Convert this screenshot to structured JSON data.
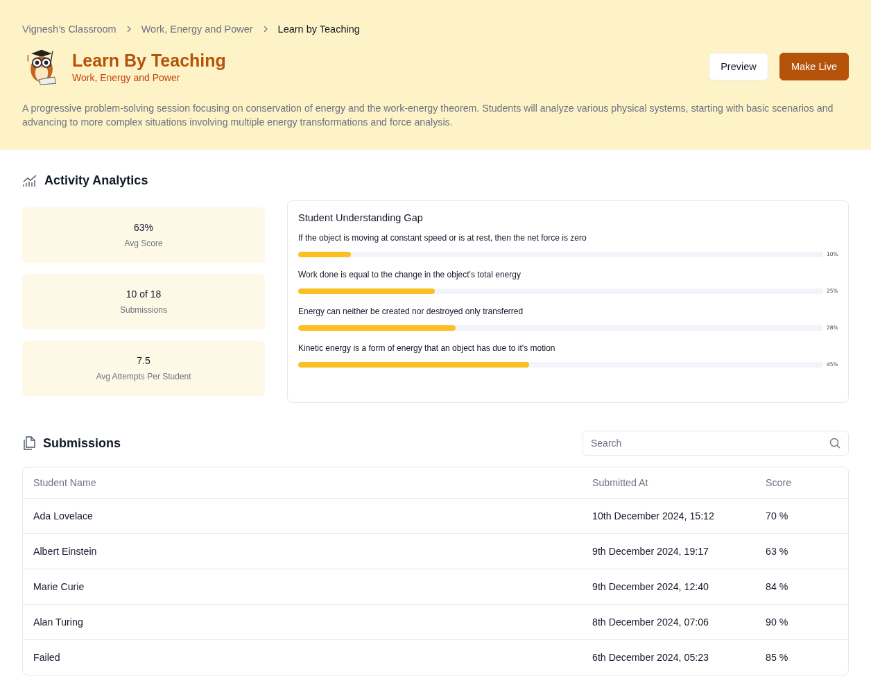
{
  "breadcrumbs": [
    {
      "label": "Vignesh’s Classroom",
      "current": false
    },
    {
      "label": "Work, Energy and Power",
      "current": false
    },
    {
      "label": "Learn by Teaching",
      "current": true
    }
  ],
  "header": {
    "title": "Learn By Teaching",
    "subtitle": "Work, Energy and Power",
    "description": "A progressive problem-solving session focusing on conservation of energy and the work-energy theorem. Students will analyze various physical systems, starting with basic scenarios and advancing to more complex situations involving multiple energy transformations and force analysis."
  },
  "buttons": [
    {
      "label": "Preview",
      "kind": "secondary"
    },
    {
      "label": "Make Live",
      "kind": "primary"
    }
  ],
  "analytics": {
    "title": "Activity Analytics",
    "stats": [
      {
        "value": "63%",
        "label": "Avg Score"
      },
      {
        "value": "10 of 18",
        "label": "Submissions"
      },
      {
        "value": "7.5",
        "label": "Avg Attempts Per Student"
      }
    ],
    "gap": {
      "title": "Student Understanding Gap",
      "items": [
        {
          "text": "If the object is moving at constant speed or is at rest, then the net force is zero",
          "level": 0.1,
          "reading": "10%"
        },
        {
          "text": "Work done is equal to the change in the object's total energy",
          "level": 0.26,
          "reading": "25%"
        },
        {
          "text": "Energy can neither be created nor destroyed only transferred",
          "level": 0.3,
          "reading": "28%"
        },
        {
          "text": "Kinetic energy is a form of energy that an object has due to it's motion",
          "level": 0.44,
          "reading": "45%"
        }
      ]
    }
  },
  "submissions": {
    "title": "Submissions",
    "search": {
      "placeholder": "Search"
    },
    "columns": [
      "Student Name",
      "Submitted At",
      "Score"
    ],
    "rows": [
      [
        "Ada Lovelace",
        "10th December 2024, 15:12",
        "70 %"
      ],
      [
        "Albert Einstein",
        "9th December 2024, 19:17",
        "63 %"
      ],
      [
        "Marie Curie",
        "9th December 2024, 12:40",
        "84 %"
      ],
      [
        "Alan Turing",
        "8th December 2024, 07:06",
        "90 %"
      ],
      [
        "Failed",
        "6th December 2024, 05:23",
        "85 %"
      ]
    ]
  }
}
